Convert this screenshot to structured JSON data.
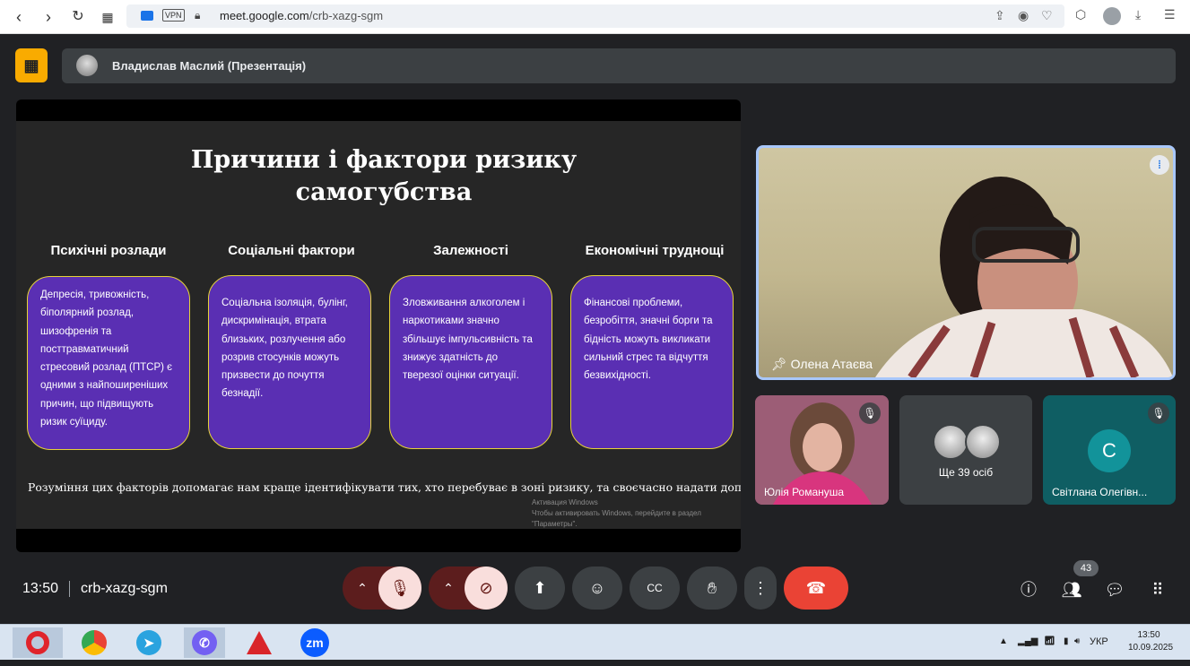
{
  "browser": {
    "url_host": "meet.google.com",
    "url_path": "/crb-xazg-sgm",
    "vpn_label": "VPN"
  },
  "presentation": {
    "presenter_title": "Владислав Маслий (Презентація)"
  },
  "slide": {
    "title_line1": "Причини і фактори ризику",
    "title_line2": "самогубства",
    "columns": [
      {
        "heading": "Психічні розлади",
        "text": "Депресія, тривожність, біполярний розлад, шизофренія та посттравматичний стресовий розлад (ПТСР) є одними з найпоширеніших причин, що підвищують ризик суїциду."
      },
      {
        "heading": "Соціальні фактори",
        "text": "Соціальна ізоляція, булінг, дискримінація, втрата близьких, розлучення або розрив стосунків можуть призвести до почуття безнадії."
      },
      {
        "heading": "Залежності",
        "text": "Зловживання алкоголем і наркотиками значно збільшує імпульсивність та знижує здатність до тверезої оцінки ситуації."
      },
      {
        "heading": "Економічні труднощі",
        "text": "Фінансові проблеми, безробіття, значні борги та бідність можуть викликати сильний стрес та відчуття безвихідності."
      }
    ],
    "footer": "Розуміння цих факторів допомагає нам краще ідентифікувати тих, хто перебуває в зоні ризику, та своєчасно надати допомогу.",
    "watermark_line1": "Активация Windows",
    "watermark_line2": "Чтобы активировать Windows, перейдите в раздел",
    "watermark_line3": "\"Параметры\"."
  },
  "participants": {
    "main": {
      "name": "Олена Атаєва"
    },
    "tile1": {
      "name": "Юлія Романуша"
    },
    "tile2": {
      "label": "Ще 39 осіб"
    },
    "tile3": {
      "name": "Світлана Олегівн...",
      "initial": "С"
    }
  },
  "meeting": {
    "time": "13:50",
    "code": "crb-xazg-sgm",
    "participant_count": "43"
  },
  "taskbar": {
    "lang": "УКР",
    "clock_time": "13:50",
    "clock_date": "10.09.2025",
    "zoom_label": "zm"
  },
  "colors": {
    "card_bg": "#5a2fb3",
    "card_border": "#e6d33a",
    "end_call": "#ea4335",
    "accent_yellow": "#f9ab00"
  }
}
